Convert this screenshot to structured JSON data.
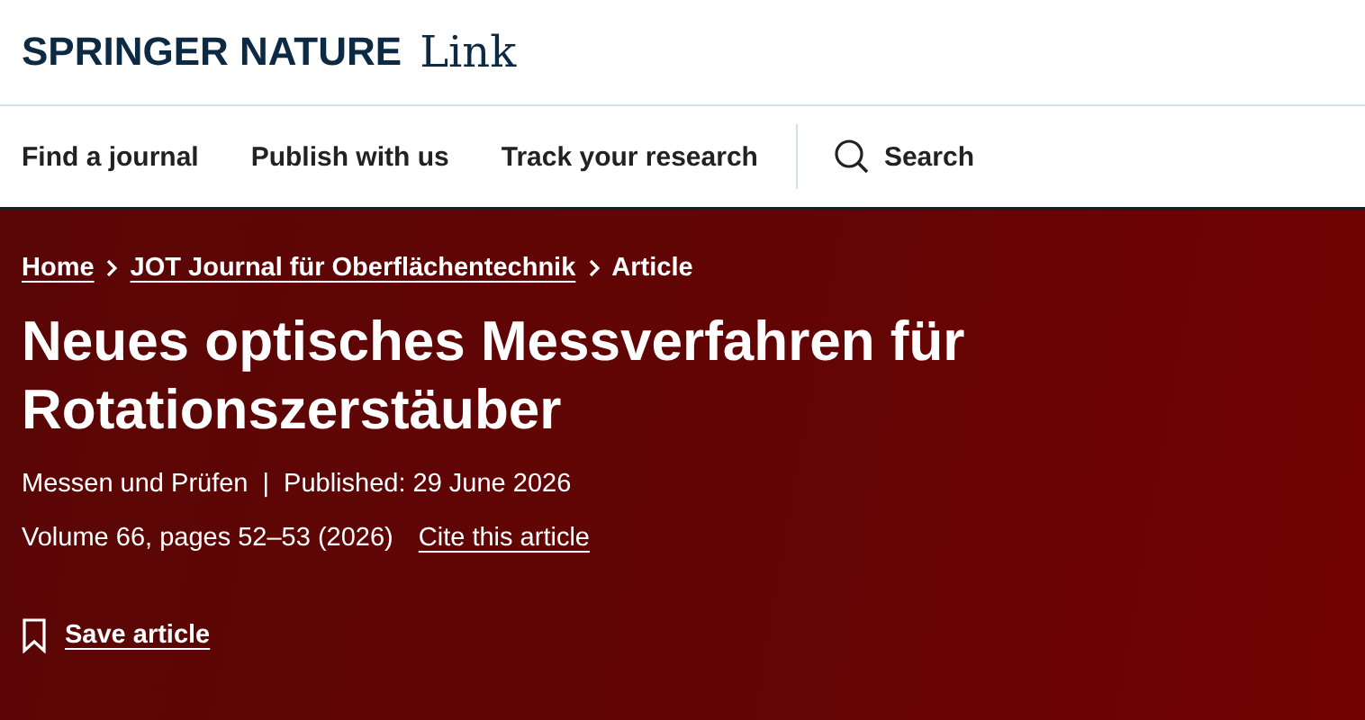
{
  "logo": {
    "brand": "SPRINGER NATURE",
    "product": "Link"
  },
  "nav": {
    "items": [
      "Find a journal",
      "Publish with us",
      "Track your research"
    ],
    "search": "Search"
  },
  "breadcrumbs": [
    {
      "label": "Home",
      "link": true
    },
    {
      "label": "JOT Journal für Oberflächentechnik",
      "link": true
    },
    {
      "label": "Article",
      "link": false
    }
  ],
  "article": {
    "title": "Neues optisches Messverfahren für Rotationszerstäuber",
    "subject": "Messen und Prüfen",
    "separator": "|",
    "published": "Published: 29 June 2026",
    "volume": "Volume 66, pages 52–53 (2026)",
    "cite": "Cite this article",
    "save": "Save article"
  }
}
